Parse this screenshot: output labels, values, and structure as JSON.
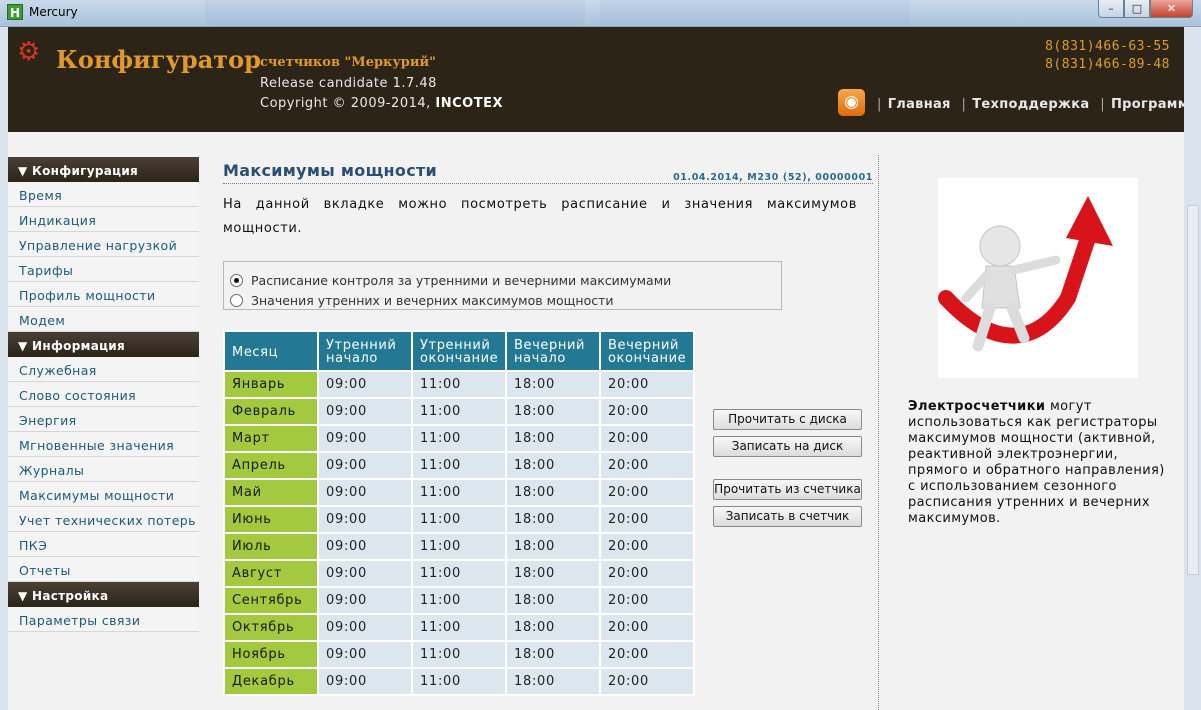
{
  "window": {
    "title": "Mercury",
    "icon_letter": "H",
    "controls": {
      "minimize": "–",
      "maximize": "□",
      "close": "✕"
    }
  },
  "header": {
    "brand": "Конфигуратор",
    "subbrand": "счетчиков \"Меркурий\"",
    "release": "Release candidate 1.7.48",
    "copyright_prefix": "Copyright © 2009-2014, ",
    "copyright_company": "INCOTEX",
    "phones": [
      "8(831)466-63-55",
      "8(831)466-89-48"
    ],
    "rss_icon": "rss-icon",
    "nav": [
      "Главная",
      "Техподдержка",
      "Программа"
    ],
    "nav_separator": "|"
  },
  "sidebar": {
    "sections": [
      {
        "title": "▼ Конфигурация",
        "items": [
          "Время",
          "Индикация",
          "Управление нагрузкой",
          "Тарифы",
          "Профиль мощности",
          "Модем"
        ]
      },
      {
        "title": "▼ Информация",
        "items": [
          "Служебная",
          "Слово состояния",
          "Энергия",
          "Мгновенные значения",
          "Журналы",
          "Максимумы мощности",
          "Учет технических потерь",
          "ПКЭ",
          "Отчеты"
        ]
      },
      {
        "title": "▼ Настройка",
        "items": [
          "Параметры связи"
        ]
      }
    ]
  },
  "main": {
    "title": "Максимумы мощности",
    "meta": "01.04.2014, M230 (52), 00000001",
    "description": "На данной вкладке можно посмотреть расписание и значения максимумов мощности.",
    "radio_options": [
      {
        "label": "Расписание контроля за утренними и вечерними максимумами",
        "checked": true
      },
      {
        "label": "Значения утренних и вечерних максимумов мощности",
        "checked": false
      }
    ],
    "table": {
      "headers": [
        [
          "Месяц",
          ""
        ],
        [
          "Утренний",
          "начало"
        ],
        [
          "Утренний",
          "окончание"
        ],
        [
          "Вечерний",
          "начало"
        ],
        [
          "Вечерний",
          "окончание"
        ]
      ],
      "rows": [
        [
          "Январь",
          "09:00",
          "11:00",
          "18:00",
          "20:00"
        ],
        [
          "Февраль",
          "09:00",
          "11:00",
          "18:00",
          "20:00"
        ],
        [
          "Март",
          "09:00",
          "11:00",
          "18:00",
          "20:00"
        ],
        [
          "Апрель",
          "09:00",
          "11:00",
          "18:00",
          "20:00"
        ],
        [
          "Май",
          "09:00",
          "11:00",
          "18:00",
          "20:00"
        ],
        [
          "Июнь",
          "09:00",
          "11:00",
          "18:00",
          "20:00"
        ],
        [
          "Июль",
          "09:00",
          "11:00",
          "18:00",
          "20:00"
        ],
        [
          "Август",
          "09:00",
          "11:00",
          "18:00",
          "20:00"
        ],
        [
          "Сентябрь",
          "09:00",
          "11:00",
          "18:00",
          "20:00"
        ],
        [
          "Октябрь",
          "09:00",
          "11:00",
          "18:00",
          "20:00"
        ],
        [
          "Ноябрь",
          "09:00",
          "11:00",
          "18:00",
          "20:00"
        ],
        [
          "Декабрь",
          "09:00",
          "11:00",
          "18:00",
          "20:00"
        ]
      ]
    },
    "buttons": {
      "read_disk": "Прочитать с диска",
      "write_disk": "Записать на диск",
      "read_meter": "Прочитать из счетчика",
      "write_meter": "Записать в счетчик"
    }
  },
  "promo": {
    "bold": "Электросчетчики",
    "text": " могут использоваться как регистраторы максимумов мощности (активной, реактивной электроэнергии, прямого и обратного направления) с использованием сезонного расписания утренних и вечерних максимумов."
  },
  "colors": {
    "header_bg": "#2d2418",
    "brand": "#e09a2c",
    "table_header": "#237994",
    "month_cell": "#a3c93e",
    "value_cell": "#dce6ee"
  }
}
